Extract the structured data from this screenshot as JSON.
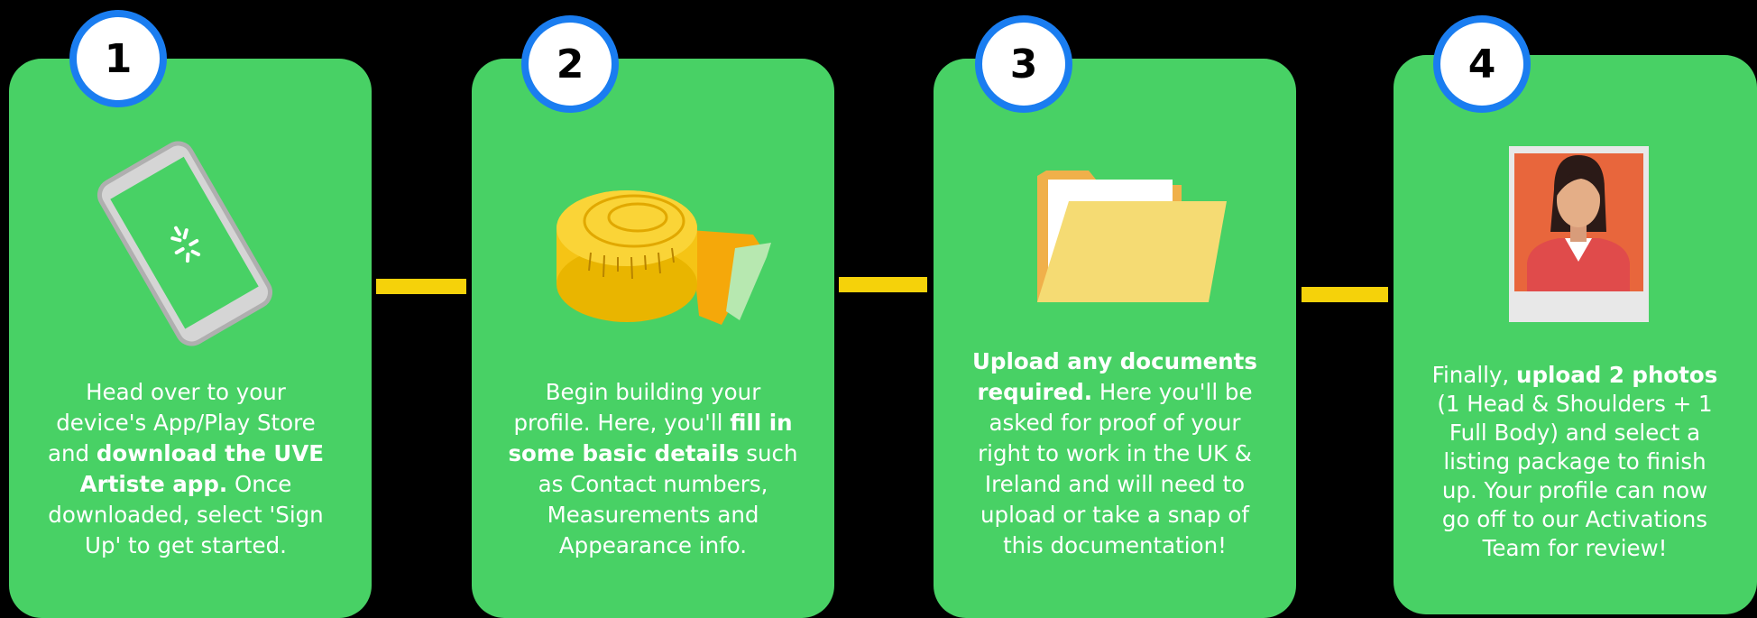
{
  "steps": [
    {
      "number": "1",
      "icon": "smartphone-icon",
      "text": [
        {
          "t": "Head over to your device's App/Play Store and ",
          "b": false
        },
        {
          "t": "download the UVE Artiste app.",
          "b": true
        },
        {
          "t": "  Once downloaded, select 'Sign Up' to get started.",
          "b": false
        }
      ]
    },
    {
      "number": "2",
      "icon": "measuring-tape-icon",
      "text": [
        {
          "t": "Begin building your profile. Here, you'll ",
          "b": false
        },
        {
          "t": "fill in some basic details",
          "b": true
        },
        {
          "t": " such as Contact numbers, Measurements and Appearance info.",
          "b": false
        }
      ]
    },
    {
      "number": "3",
      "icon": "folder-icon",
      "text": [
        {
          "t": "Upload any documents required.",
          "b": true
        },
        {
          "t": " Here you'll be asked for proof of your right to work in the UK & Ireland and will need to upload or take a snap of this documentation!",
          "b": false
        }
      ]
    },
    {
      "number": "4",
      "icon": "photo-portrait-icon",
      "text": [
        {
          "t": "Finally, ",
          "b": false
        },
        {
          "t": "upload 2 photos",
          "b": true
        },
        {
          "t": " (1 Head & Shoulders + 1 Full Body) and select a listing package to finish up. Your profile can now go off to our Activations Team for review!",
          "b": false
        }
      ]
    }
  ],
  "colors": {
    "background": "#000000",
    "card": "#48D165",
    "badge_ring": "#1A7DF0",
    "connector": "#F5D20A"
  }
}
